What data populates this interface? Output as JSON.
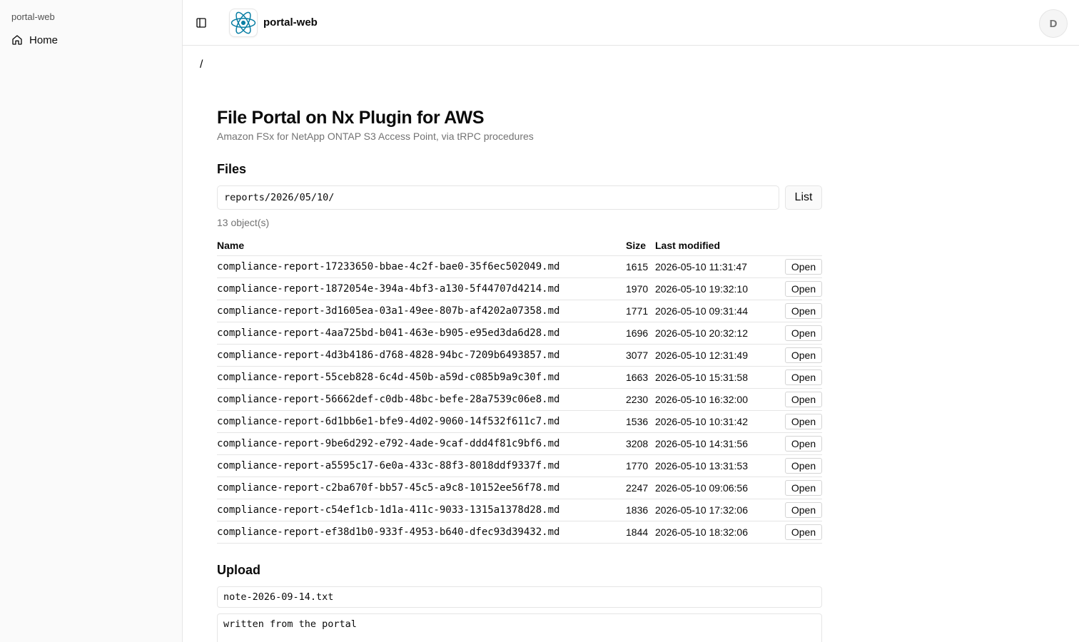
{
  "sidebar": {
    "group_label": "portal-web",
    "items": [
      {
        "label": "Home",
        "icon": "home-icon"
      }
    ]
  },
  "header": {
    "app_name": "portal-web",
    "logo_icon": "react-logo-icon",
    "toggle_icon": "sidebar-toggle-icon",
    "avatar_initial": "D"
  },
  "breadcrumb": "/",
  "main": {
    "title": "File Portal on Nx Plugin for AWS",
    "subtitle": "Amazon FSx for NetApp ONTAP S3 Access Point, via tRPC procedures"
  },
  "files": {
    "section_title": "Files",
    "prefix_value": "reports/2026/05/10/",
    "list_label": "List",
    "count_text": "13 object(s)",
    "columns": {
      "name": "Name",
      "size": "Size",
      "modified": "Last modified"
    },
    "open_label": "Open",
    "rows": [
      {
        "name": "compliance-report-17233650-bbae-4c2f-bae0-35f6ec502049.md",
        "size": "1615",
        "modified": "2026-05-10 11:31:47"
      },
      {
        "name": "compliance-report-1872054e-394a-4bf3-a130-5f44707d4214.md",
        "size": "1970",
        "modified": "2026-05-10 19:32:10"
      },
      {
        "name": "compliance-report-3d1605ea-03a1-49ee-807b-af4202a07358.md",
        "size": "1771",
        "modified": "2026-05-10 09:31:44"
      },
      {
        "name": "compliance-report-4aa725bd-b041-463e-b905-e95ed3da6d28.md",
        "size": "1696",
        "modified": "2026-05-10 20:32:12"
      },
      {
        "name": "compliance-report-4d3b4186-d768-4828-94bc-7209b6493857.md",
        "size": "3077",
        "modified": "2026-05-10 12:31:49"
      },
      {
        "name": "compliance-report-55ceb828-6c4d-450b-a59d-c085b9a9c30f.md",
        "size": "1663",
        "modified": "2026-05-10 15:31:58"
      },
      {
        "name": "compliance-report-56662def-c0db-48bc-befe-28a7539c06e8.md",
        "size": "2230",
        "modified": "2026-05-10 16:32:00"
      },
      {
        "name": "compliance-report-6d1bb6e1-bfe9-4d02-9060-14f532f611c7.md",
        "size": "1536",
        "modified": "2026-05-10 10:31:42"
      },
      {
        "name": "compliance-report-9be6d292-e792-4ade-9caf-ddd4f81c9bf6.md",
        "size": "3208",
        "modified": "2026-05-10 14:31:56"
      },
      {
        "name": "compliance-report-a5595c17-6e0a-433c-88f3-8018ddf9337f.md",
        "size": "1770",
        "modified": "2026-05-10 13:31:53"
      },
      {
        "name": "compliance-report-c2ba670f-bb57-45c5-a9c8-10152ee56f78.md",
        "size": "2247",
        "modified": "2026-05-10 09:06:56"
      },
      {
        "name": "compliance-report-c54ef1cb-1d1a-411c-9033-1315a1378d28.md",
        "size": "1836",
        "modified": "2026-05-10 17:32:06"
      },
      {
        "name": "compliance-report-ef38d1b0-933f-4953-b640-dfec93d39432.md",
        "size": "1844",
        "modified": "2026-05-10 18:32:06"
      }
    ]
  },
  "upload": {
    "section_title": "Upload",
    "filename_value": "note-2026-09-14.txt",
    "content_value": "written from the portal"
  },
  "colors": {
    "text": "#0a0a0a",
    "muted": "#737373",
    "border": "#e5e5e5",
    "sidebar_bg": "#fafafa",
    "react_blue": "#087ea4"
  }
}
